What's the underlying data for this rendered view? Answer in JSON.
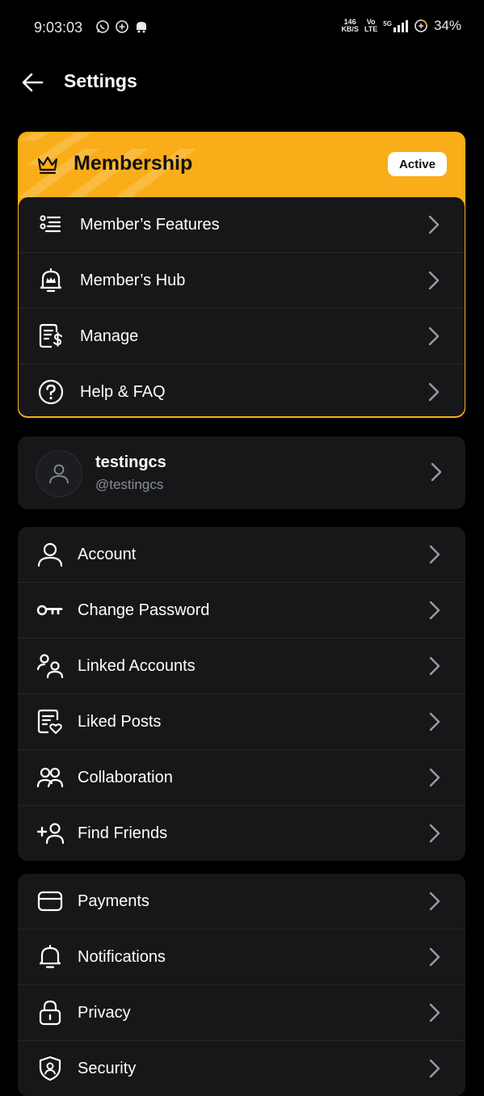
{
  "status_bar": {
    "time": "9:03:03",
    "net_speed_top": "146",
    "net_speed_bottom": "KB/S",
    "volte_top": "Vo",
    "volte_bottom": "LTE",
    "network": "5G",
    "battery": "34%"
  },
  "header": {
    "title": "Settings"
  },
  "membership": {
    "title": "Membership",
    "badge": "Active",
    "accent": "#f9ad18",
    "items": [
      {
        "label": "Member’s Features",
        "icon": "list-icon"
      },
      {
        "label": "Member’s Hub",
        "icon": "bell-crown-icon"
      },
      {
        "label": "Manage",
        "icon": "billing-document-icon"
      },
      {
        "label": "Help & FAQ",
        "icon": "help-circle-icon"
      }
    ]
  },
  "profile": {
    "name": "testingcs",
    "handle": "@testingcs"
  },
  "account_section": {
    "items": [
      {
        "label": "Account",
        "icon": "person-icon"
      },
      {
        "label": "Change Password",
        "icon": "key-icon"
      },
      {
        "label": "Linked Accounts",
        "icon": "linked-accounts-icon"
      },
      {
        "label": "Liked Posts",
        "icon": "liked-posts-icon"
      },
      {
        "label": "Collaboration",
        "icon": "collaboration-icon"
      },
      {
        "label": "Find Friends",
        "icon": "add-friend-icon"
      }
    ]
  },
  "preferences_section": {
    "items": [
      {
        "label": "Payments",
        "icon": "card-icon"
      },
      {
        "label": "Notifications",
        "icon": "bell-icon"
      },
      {
        "label": "Privacy",
        "icon": "lock-icon"
      },
      {
        "label": "Security",
        "icon": "shield-icon"
      }
    ]
  }
}
